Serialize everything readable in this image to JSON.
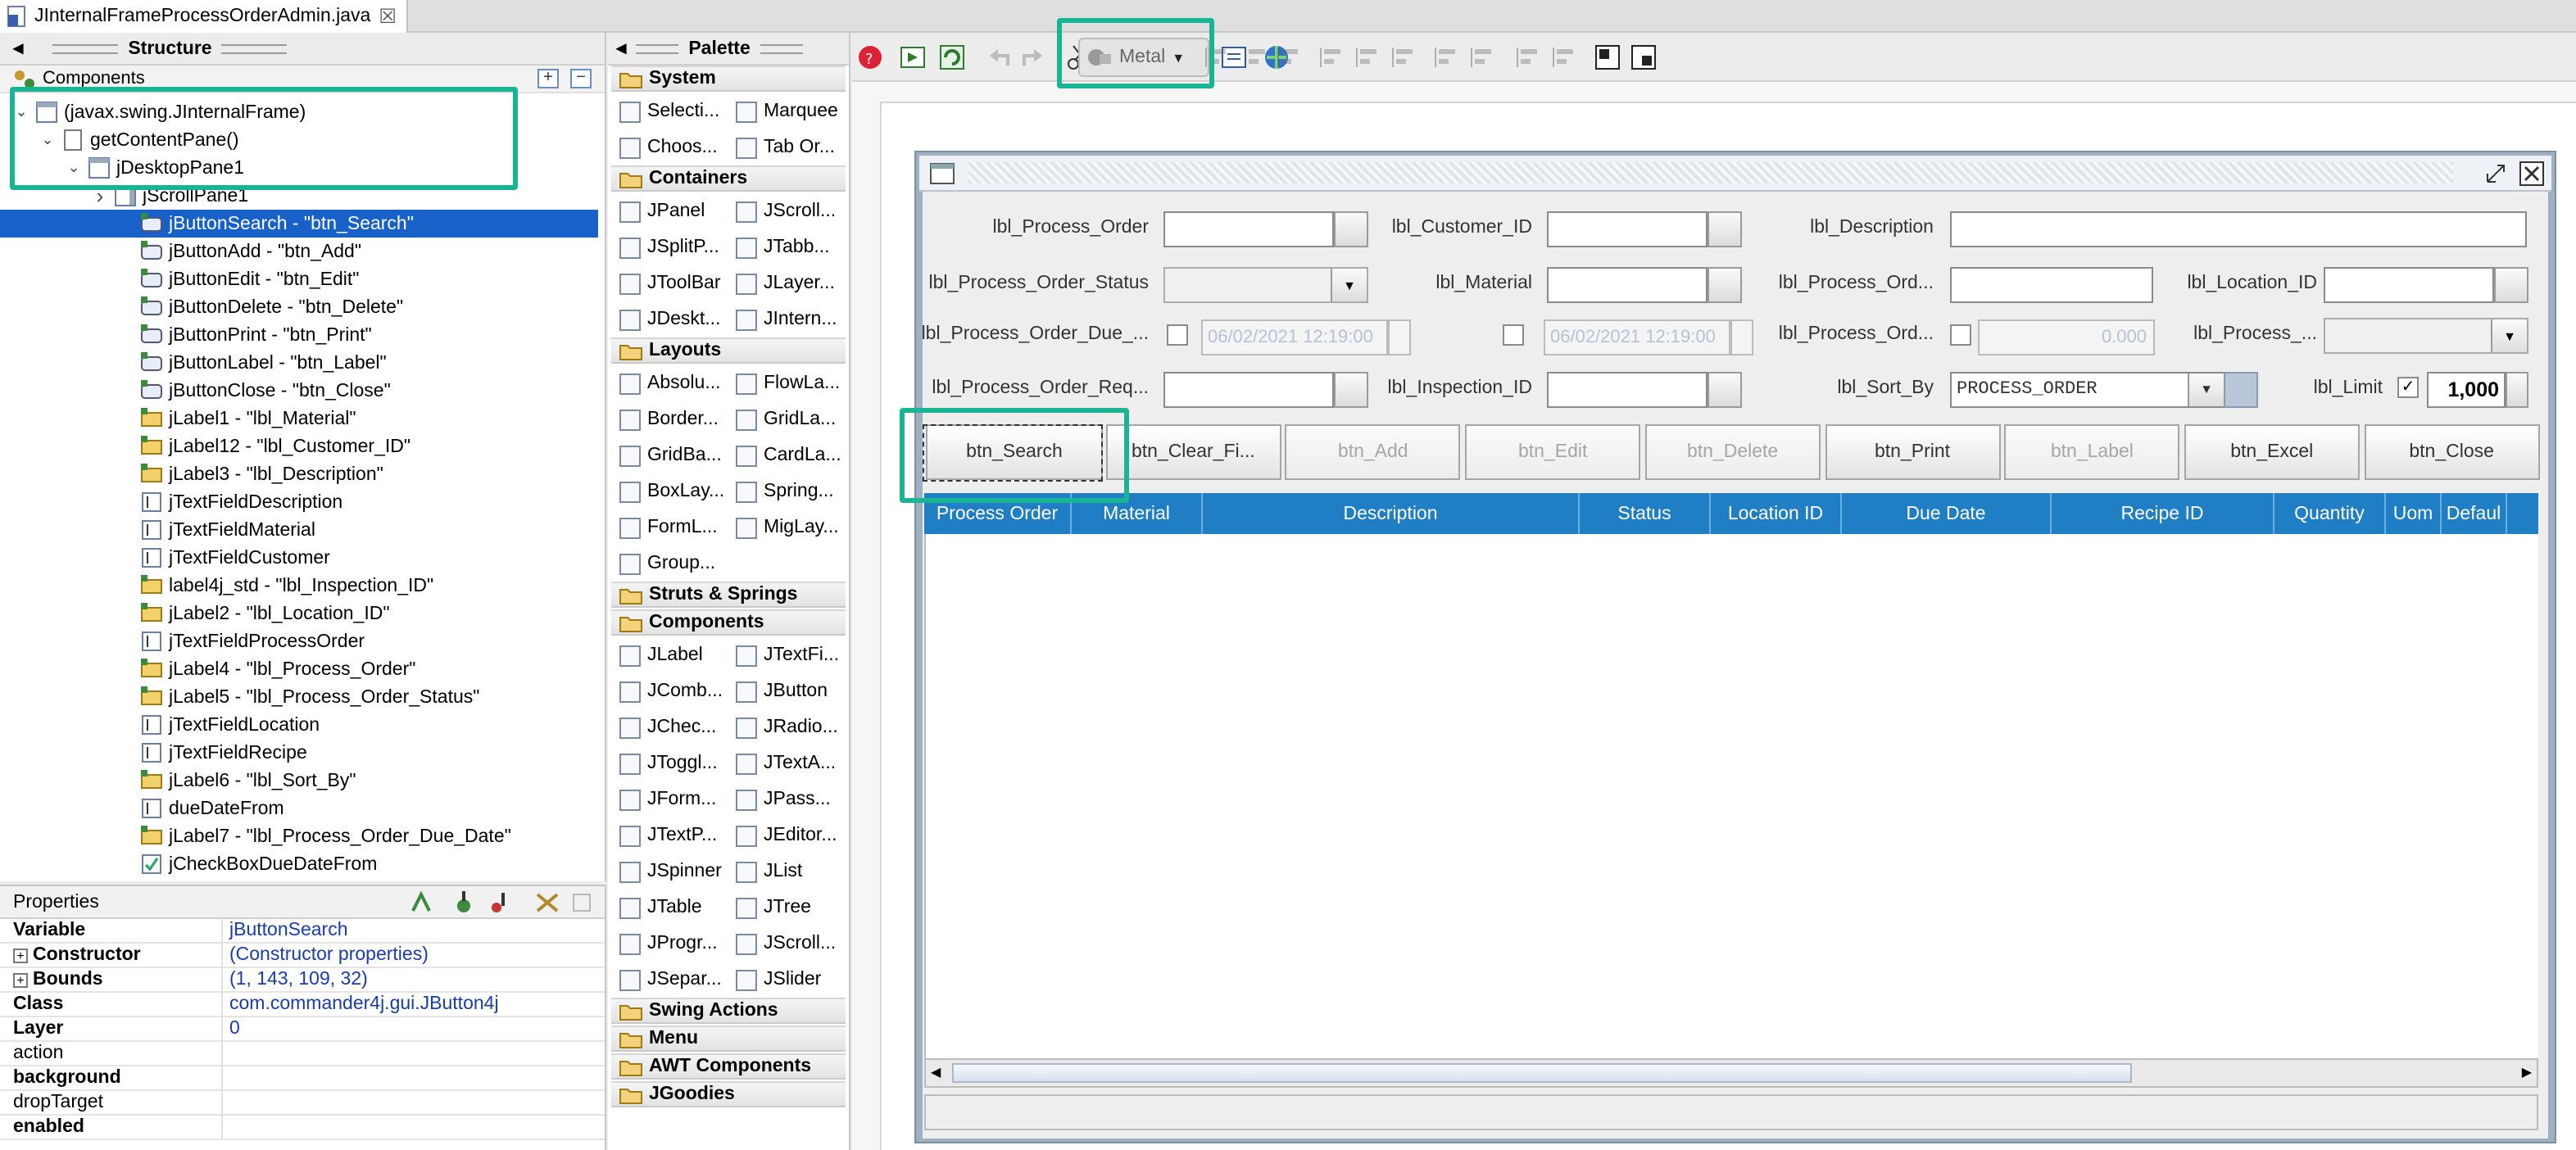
{
  "editor_tab": {
    "title": "JInternalFrameProcessOrderAdmin.java"
  },
  "structure": {
    "title": "Structure",
    "components_label": "Components",
    "tree": [
      {
        "label": "(javax.swing.JInternalFrame)",
        "depth": 0,
        "expanded": true,
        "icon": "frame-icon"
      },
      {
        "label": "getContentPane()",
        "depth": 1,
        "expanded": true,
        "icon": "page-icon"
      },
      {
        "label": "jDesktopPane1",
        "depth": 2,
        "expanded": true,
        "icon": "frame-icon"
      },
      {
        "label": "jScrollPane1",
        "depth": 3,
        "expanded": false,
        "icon": "scroll-icon"
      },
      {
        "label": "jButtonSearch - \"btn_Search\"",
        "depth": 4,
        "selected": true,
        "icon": "button-icon"
      },
      {
        "label": "jButtonAdd - \"btn_Add\"",
        "depth": 4,
        "icon": "button-icon"
      },
      {
        "label": "jButtonEdit - \"btn_Edit\"",
        "depth": 4,
        "icon": "button-icon"
      },
      {
        "label": "jButtonDelete - \"btn_Delete\"",
        "depth": 4,
        "icon": "button-icon"
      },
      {
        "label": "jButtonPrint - \"btn_Print\"",
        "depth": 4,
        "icon": "button-icon"
      },
      {
        "label": "jButtonLabel - \"btn_Label\"",
        "depth": 4,
        "icon": "button-icon"
      },
      {
        "label": "jButtonClose - \"btn_Close\"",
        "depth": 4,
        "icon": "button-icon"
      },
      {
        "label": "jLabel1 - \"lbl_Material\"",
        "depth": 4,
        "icon": "label-icon"
      },
      {
        "label": "jLabel12 - \"lbl_Customer_ID\"",
        "depth": 4,
        "icon": "label-icon"
      },
      {
        "label": "jLabel3 - \"lbl_Description\"",
        "depth": 4,
        "icon": "label-icon"
      },
      {
        "label": "jTextFieldDescription",
        "depth": 4,
        "icon": "textfield-icon"
      },
      {
        "label": "jTextFieldMaterial",
        "depth": 4,
        "icon": "textfield-icon"
      },
      {
        "label": "jTextFieldCustomer",
        "depth": 4,
        "icon": "textfield-icon"
      },
      {
        "label": "label4j_std - \"lbl_Inspection_ID\"",
        "depth": 4,
        "icon": "label-icon"
      },
      {
        "label": "jLabel2 - \"lbl_Location_ID\"",
        "depth": 4,
        "icon": "label-icon"
      },
      {
        "label": "jTextFieldProcessOrder",
        "depth": 4,
        "icon": "textfield-icon"
      },
      {
        "label": "jLabel4 - \"lbl_Process_Order\"",
        "depth": 4,
        "icon": "label-icon"
      },
      {
        "label": "jLabel5 - \"lbl_Process_Order_Status\"",
        "depth": 4,
        "icon": "label-icon"
      },
      {
        "label": "jTextFieldLocation",
        "depth": 4,
        "icon": "textfield-icon"
      },
      {
        "label": "jTextFieldRecipe",
        "depth": 4,
        "icon": "textfield-icon"
      },
      {
        "label": "jLabel6 - \"lbl_Sort_By\"",
        "depth": 4,
        "icon": "label-icon"
      },
      {
        "label": "dueDateFrom",
        "depth": 4,
        "icon": "textfield-icon"
      },
      {
        "label": "jLabel7 - \"lbl_Process_Order_Due_Date\"",
        "depth": 4,
        "icon": "label-icon"
      },
      {
        "label": "jCheckBoxDueDateFrom",
        "depth": 4,
        "icon": "checkbox-icon"
      }
    ]
  },
  "properties": {
    "title": "Properties",
    "rows": [
      {
        "key": "Variable",
        "value": "jButtonSearch"
      },
      {
        "key": "Constructor",
        "value": "(Constructor properties)",
        "expandable": true
      },
      {
        "key": "Bounds",
        "value": "(1, 143, 109, 32)",
        "expandable": true
      },
      {
        "key": "Class",
        "value": "com.commander4j.gui.JButton4j"
      },
      {
        "key": "Layer",
        "value": "0"
      },
      {
        "key": "action",
        "value": "",
        "normal": true
      },
      {
        "key": "background",
        "value": ""
      },
      {
        "key": "dropTarget",
        "value": "",
        "normal": true
      },
      {
        "key": "enabled",
        "value": ""
      }
    ]
  },
  "palette": {
    "title": "Palette",
    "sections": [
      {
        "name": "System",
        "items": [
          [
            "Selecti...",
            "Marquee"
          ],
          [
            "Choos...",
            "Tab Or..."
          ]
        ]
      },
      {
        "name": "Containers",
        "items": [
          [
            "JPanel",
            "JScroll..."
          ],
          [
            "JSplitP...",
            "JTabb..."
          ],
          [
            "JToolBar",
            "JLayer..."
          ],
          [
            "JDeskt...",
            "JIntern..."
          ]
        ]
      },
      {
        "name": "Layouts",
        "items": [
          [
            "Absolu...",
            "FlowLa..."
          ],
          [
            "Border...",
            "GridLa..."
          ],
          [
            "GridBa...",
            "CardLa..."
          ],
          [
            "BoxLay...",
            "Spring..."
          ],
          [
            "FormL...",
            "MigLay..."
          ],
          [
            "Group...",
            ""
          ]
        ]
      },
      {
        "name": "Struts & Springs",
        "items": []
      },
      {
        "name": "Components",
        "items": [
          [
            "JLabel",
            "JTextFi..."
          ],
          [
            "JComb...",
            "JButton"
          ],
          [
            "JChec...",
            "JRadio..."
          ],
          [
            "JToggl...",
            "JTextA..."
          ],
          [
            "JForm...",
            "JPass..."
          ],
          [
            "JTextP...",
            "JEditor..."
          ],
          [
            "JSpinner",
            "JList"
          ],
          [
            "JTable",
            "JTree"
          ],
          [
            "JProgr...",
            "JScroll..."
          ],
          [
            "JSepar...",
            "JSlider"
          ]
        ]
      },
      {
        "name": "Swing Actions",
        "items": []
      },
      {
        "name": "Menu",
        "items": []
      },
      {
        "name": "AWT Components",
        "items": []
      },
      {
        "name": "JGoodies",
        "items": []
      }
    ]
  },
  "toolbar": {
    "look_and_feel": "Metal"
  },
  "form": {
    "labels": {
      "process_order": "lbl_Process_Order",
      "customer_id": "lbl_Customer_ID",
      "description": "lbl_Description",
      "status": "lbl_Process_Order_Status",
      "material": "lbl_Material",
      "process_ord_a": "lbl_Process_Ord...",
      "location_id": "lbl_Location_ID",
      "due_date": "lbl_Process_Order_Due_...",
      "process_ord_b": "lbl_Process_Ord...",
      "process_c": "lbl_Process_...",
      "req": "lbl_Process_Order_Req...",
      "inspection_id": "lbl_Inspection_ID",
      "sort_by": "lbl_Sort_By",
      "limit": "lbl_Limit"
    },
    "date_from": "06/02/2021 12:19:00",
    "date_to": "06/02/2021 12:19:00",
    "quantity": "0.000",
    "sort_by_value": "PROCESS_ORDER",
    "limit_value": "1,000",
    "limit_checked": true,
    "buttons": [
      {
        "label": "btn_Search",
        "enabled": true,
        "selected": true
      },
      {
        "label": "btn_Clear_Fi...",
        "enabled": true
      },
      {
        "label": "btn_Add",
        "enabled": false
      },
      {
        "label": "btn_Edit",
        "enabled": false
      },
      {
        "label": "btn_Delete",
        "enabled": false
      },
      {
        "label": "btn_Print",
        "enabled": true
      },
      {
        "label": "btn_Label",
        "enabled": false
      },
      {
        "label": "btn_Excel",
        "enabled": true
      },
      {
        "label": "btn_Close",
        "enabled": true
      }
    ],
    "table_columns": [
      "Process Order",
      "Material",
      "Description",
      "Status",
      "Location ID",
      "Due Date",
      "Recipe ID",
      "Quantity",
      "Uom",
      "Defaul"
    ]
  },
  "colors": {
    "selection": "#1861c8",
    "table_header": "#1f7ec4",
    "highlight": "#1ab394"
  }
}
